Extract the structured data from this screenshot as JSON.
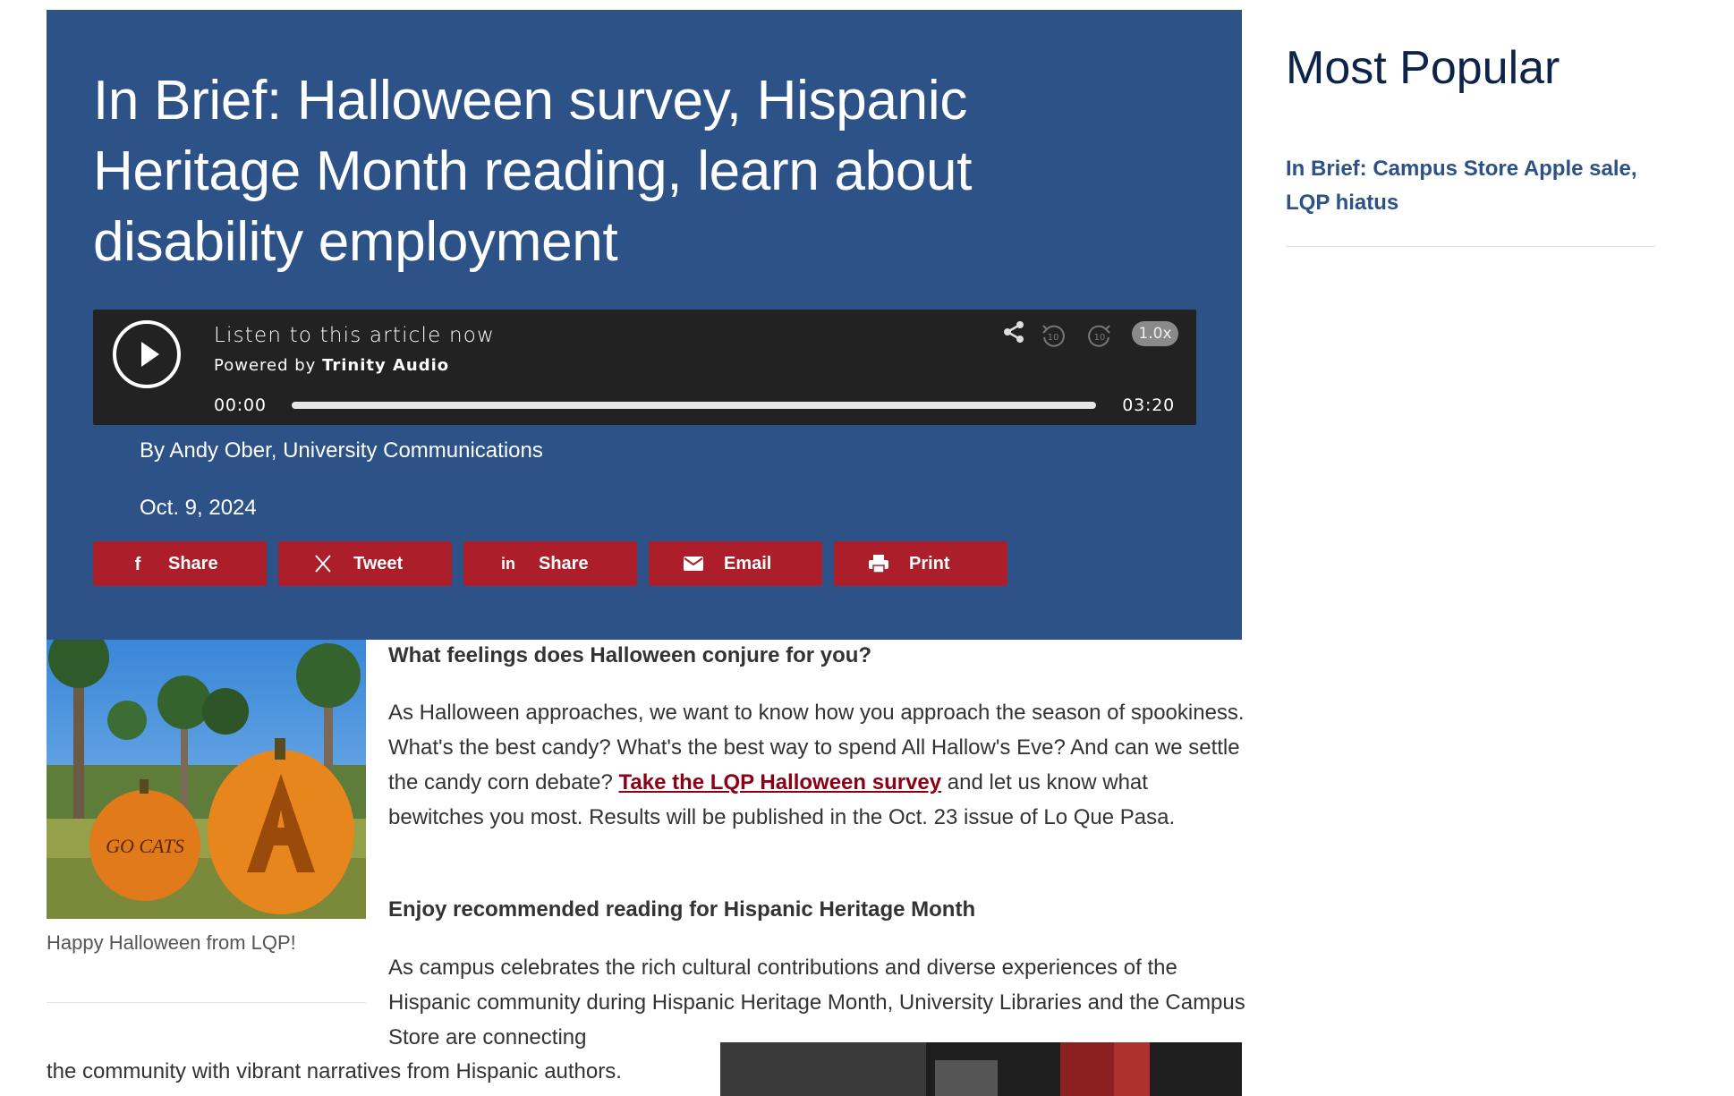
{
  "article": {
    "title": "In Brief: Halloween survey, Hispanic Heritage Month reading, learn about disability employment",
    "byline": "By Andy Ober, University Communications",
    "date": "Oct. 9, 2024"
  },
  "audio_player": {
    "heading": "Listen to this article now",
    "powered_prefix": "Powered by",
    "powered_brand": "Trinity Audio",
    "current_time": "00:00",
    "total_time": "03:20",
    "progress": 0,
    "rewind_label": "10",
    "forward_label": "10",
    "speed": "1.0x",
    "icons": [
      "play-icon",
      "share-icon",
      "rewind-10-icon",
      "forward-10-icon"
    ]
  },
  "share_buttons": [
    {
      "icon": "facebook-icon",
      "label": "Share"
    },
    {
      "icon": "x-icon",
      "label": "Tweet"
    },
    {
      "icon": "linkedin-icon",
      "label": "Share"
    },
    {
      "icon": "email-icon",
      "label": "Email"
    },
    {
      "icon": "print-icon",
      "label": "Print"
    }
  ],
  "image": {
    "pumpkin_carving": "GO CATS",
    "caption": "Happy Halloween from LQP!"
  },
  "body": {
    "heading1": "What feelings does Halloween conjure for you?",
    "p1_before": "As Halloween approaches, we want to know how you approach the season of spookiness. What's the best candy? What's the best way to spend All Hallow's Eve? And can we settle the candy corn debate? ",
    "p1_link": "Take the LQP Halloween survey",
    "p1_after": " and let us know what bewitches you most. Results will be published in the Oct. 23 issue of Lo Que Pasa.",
    "heading2": "Enjoy recommended reading for Hispanic Heritage Month",
    "p2_a": "As campus celebrates the rich cultural contributions and diverse experiences of the Hispanic community during Hispanic Heritage Month, University Libraries and the Campus Store are connecting",
    "p2_b": "the community with vibrant narratives from Hispanic authors."
  },
  "sidebar": {
    "title": "Most Popular",
    "items": [
      {
        "label": "In Brief: Campus Store Apple sale, LQP hiatus"
      }
    ]
  },
  "colors": {
    "hero_bg": "#2c5288",
    "share_btn": "#ab1e2a",
    "link": "#8b0015",
    "sidebar_title": "#0c234b",
    "sidebar_link": "#2c5288"
  }
}
